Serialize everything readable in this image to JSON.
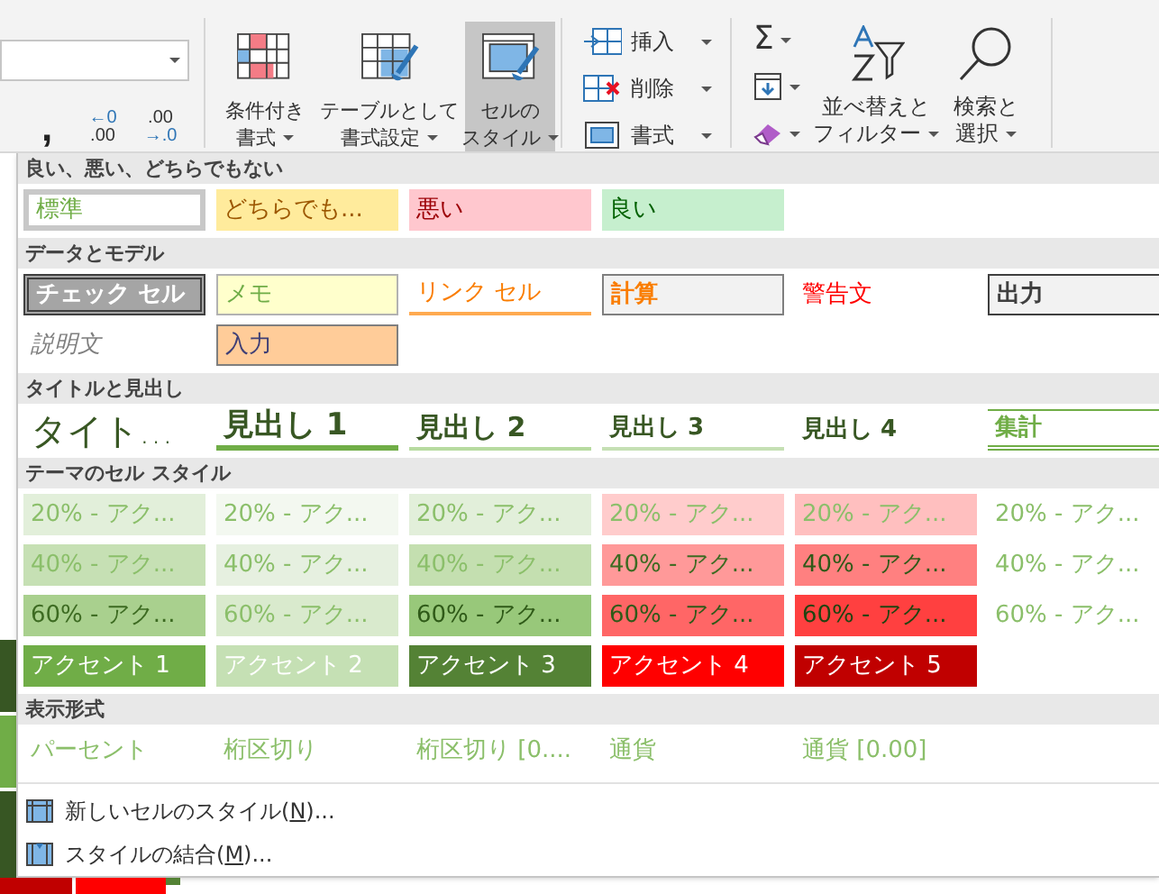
{
  "ribbon": {
    "number_format_field": {
      "kind": "dropdown"
    },
    "number_buttons": [
      {
        "kind": "comma",
        "lines": [
          ","
        ]
      },
      {
        "kind": "inc",
        "lines": [
          "←0",
          ".00"
        ]
      },
      {
        "kind": "dec",
        "lines": [
          ".00",
          "→.0"
        ]
      }
    ],
    "style_buttons": [
      {
        "kind": "conditional",
        "lines": [
          "条件付き",
          "書式"
        ],
        "selected": false
      },
      {
        "kind": "table",
        "lines": [
          "テーブルとして",
          "書式設定"
        ],
        "selected": false
      },
      {
        "kind": "cellstyle",
        "lines": [
          "セルの",
          "スタイル"
        ],
        "selected": true
      }
    ],
    "cell_buttons": [
      {
        "kind": "insert",
        "label": "挿入"
      },
      {
        "kind": "delete",
        "label": "削除"
      },
      {
        "kind": "format",
        "label": "書式"
      }
    ],
    "edit_small": [
      {
        "kind": "sum",
        "label": "Σ"
      },
      {
        "kind": "fill"
      },
      {
        "kind": "clear"
      }
    ],
    "edit_buttons": [
      {
        "kind": "sort",
        "lines": [
          "並べ替えと",
          "フィルター"
        ]
      },
      {
        "kind": "find",
        "lines": [
          "検索と",
          "選択"
        ]
      }
    ]
  },
  "gallery": {
    "sections": [
      {
        "title": "良い、悪い、どちらでもない",
        "rows": [
          [
            {
              "label": "標準",
              "kind": "normal"
            },
            {
              "label": "どちらでも...",
              "kind": "neutral"
            },
            {
              "label": "悪い",
              "kind": "bad"
            },
            {
              "label": "良い",
              "kind": "good"
            }
          ]
        ]
      },
      {
        "title": "データとモデル",
        "rows": [
          [
            {
              "label": "チェック セル",
              "kind": "check"
            },
            {
              "label": "メモ",
              "kind": "memo"
            },
            {
              "label": "リンク セル",
              "kind": "link"
            },
            {
              "label": "計算",
              "kind": "calc"
            },
            {
              "label": "警告文",
              "kind": "warning"
            },
            {
              "label": "出力",
              "kind": "output"
            }
          ],
          [
            {
              "label": "説明文",
              "kind": "explanatory"
            },
            {
              "label": "入力",
              "kind": "input"
            }
          ]
        ]
      },
      {
        "title": "タイトルと見出し",
        "rows": [
          [
            {
              "label": "タイト...",
              "kind": "title"
            },
            {
              "label": "見出し 1",
              "kind": "h1"
            },
            {
              "label": "見出し 2",
              "kind": "h2"
            },
            {
              "label": "見出し 3",
              "kind": "h3"
            },
            {
              "label": "見出し 4",
              "kind": "h4"
            },
            {
              "label": "集計",
              "kind": "total"
            }
          ]
        ]
      },
      {
        "title": "テーマのセル スタイル",
        "rows": [
          [
            {
              "label": "20% - アク...",
              "kind": "a20-1"
            },
            {
              "label": "20% - アク...",
              "kind": "a20-2"
            },
            {
              "label": "20% - アク...",
              "kind": "a20-3"
            },
            {
              "label": "20% - アク...",
              "kind": "a20-4"
            },
            {
              "label": "20% - アク...",
              "kind": "a20-5"
            },
            {
              "label": "20% - アク...",
              "kind": "a20-6"
            }
          ],
          [
            {
              "label": "40% - アク...",
              "kind": "a40-1"
            },
            {
              "label": "40% - アク...",
              "kind": "a40-2"
            },
            {
              "label": "40% - アク...",
              "kind": "a40-3"
            },
            {
              "label": "40% - アク...",
              "kind": "a40-4"
            },
            {
              "label": "40% - アク...",
              "kind": "a40-5"
            },
            {
              "label": "40% - アク...",
              "kind": "a40-6"
            }
          ],
          [
            {
              "label": "60% - アク...",
              "kind": "a60-1"
            },
            {
              "label": "60% - アク...",
              "kind": "a60-2"
            },
            {
              "label": "60% - アク...",
              "kind": "a60-3"
            },
            {
              "label": "60% - アク...",
              "kind": "a60-4"
            },
            {
              "label": "60% - アク...",
              "kind": "a60-5"
            },
            {
              "label": "60% - アク...",
              "kind": "a60-6"
            }
          ],
          [
            {
              "label": "アクセント 1",
              "kind": "acc-1"
            },
            {
              "label": "アクセント 2",
              "kind": "acc-2"
            },
            {
              "label": "アクセント 3",
              "kind": "acc-3"
            },
            {
              "label": "アクセント 4",
              "kind": "acc-4"
            },
            {
              "label": "アクセント 5",
              "kind": "acc-5"
            }
          ]
        ]
      },
      {
        "title": "表示形式",
        "rows": [
          [
            {
              "label": "パーセント",
              "kind": "num"
            },
            {
              "label": "桁区切り",
              "kind": "num"
            },
            {
              "label": "桁区切り [0....",
              "kind": "num"
            },
            {
              "label": "通貨",
              "kind": "num"
            },
            {
              "label": "通貨 [0.00]",
              "kind": "num"
            }
          ]
        ]
      }
    ],
    "menu": [
      {
        "kind": "new",
        "label": "新しいセルのスタイル(**N**)..."
      },
      {
        "kind": "merge",
        "label": "スタイルの結合(**M**)..."
      }
    ]
  }
}
